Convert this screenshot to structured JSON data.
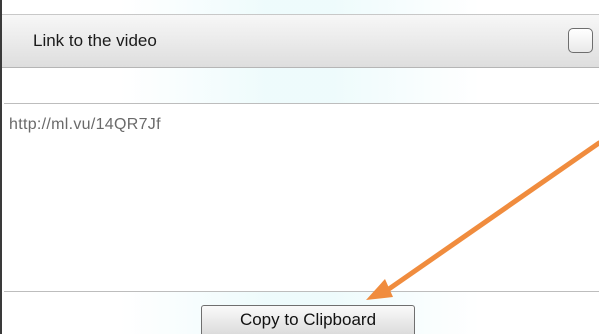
{
  "dialog": {
    "title": "Link to the video",
    "header_checkbox_checked": false
  },
  "link_field": {
    "value": "http://ml.vu/14QR7Jf"
  },
  "copy_button": {
    "label": "Copy to Clipboard"
  },
  "annotation": {
    "arrow_color": "#f08c3e",
    "arrow_target": "copy-to-clipboard-button"
  },
  "colors": {
    "header_gradient_top": "#f7f7f7",
    "header_gradient_bottom": "#dedede",
    "link_text": "#6a6a6a"
  }
}
